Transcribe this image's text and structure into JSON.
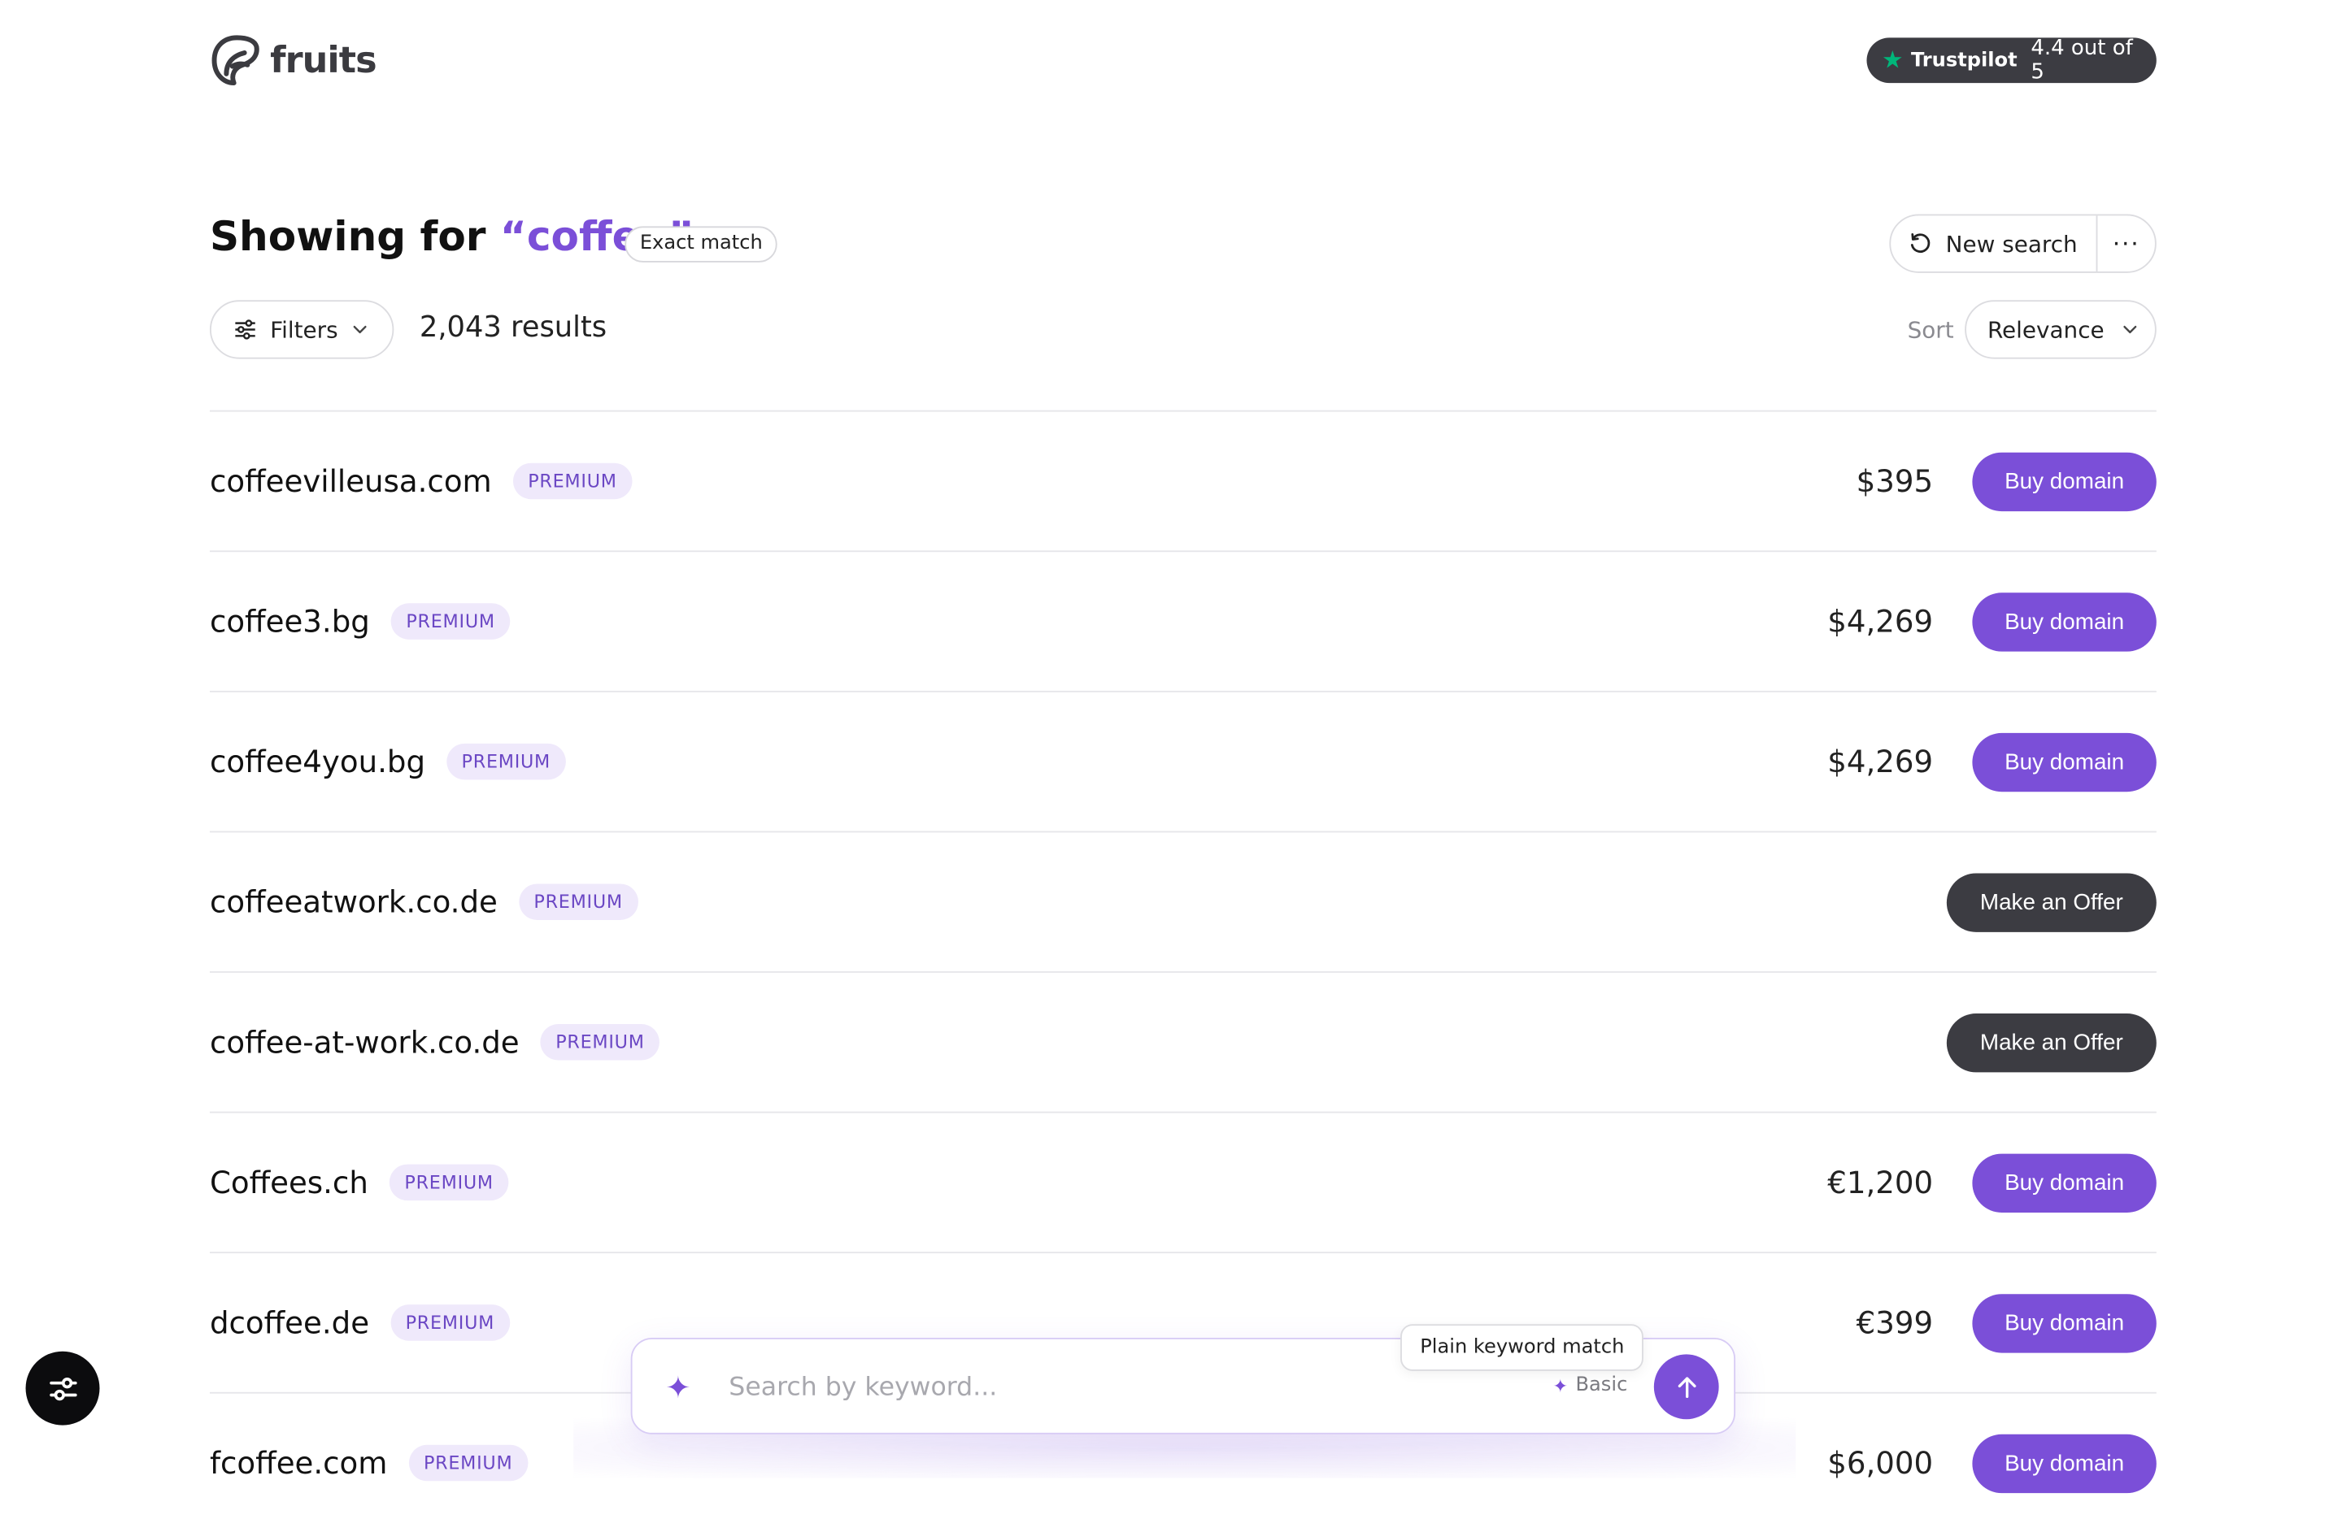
{
  "brand": {
    "name": "fruits"
  },
  "trustpilot": {
    "brand": "Trustpilot",
    "score": "4.4 out of 5"
  },
  "header": {
    "prefix": "Showing for ",
    "query": "“coffee”",
    "match_badge": "Exact match",
    "new_search": "New search",
    "more": "···"
  },
  "toolbar": {
    "filters": "Filters",
    "results": "2,043 results",
    "sort_label": "Sort",
    "sort_value": "Relevance"
  },
  "rows": [
    {
      "domain": "coffeevilleusa.com",
      "badge": "PREMIUM",
      "price": "$395",
      "action": "Buy domain"
    },
    {
      "domain": "coffee3.bg",
      "badge": "PREMIUM",
      "price": "$4,269",
      "action": "Buy domain"
    },
    {
      "domain": "coffee4you.bg",
      "badge": "PREMIUM",
      "price": "$4,269",
      "action": "Buy domain"
    },
    {
      "domain": "coffeeatwork.co.de",
      "badge": "PREMIUM",
      "price": "",
      "action": "Make an Offer"
    },
    {
      "domain": "coffee-at-work.co.de",
      "badge": "PREMIUM",
      "price": "",
      "action": "Make an Offer"
    },
    {
      "domain": "Coffees.ch",
      "badge": "PREMIUM",
      "price": "€1,200",
      "action": "Buy domain"
    },
    {
      "domain": "dcoffee.de",
      "badge": "PREMIUM",
      "price": "€399",
      "action": "Buy domain"
    },
    {
      "domain": "fcoffee.com",
      "badge": "PREMIUM",
      "price": "$6,000",
      "action": "Buy domain"
    }
  ],
  "search": {
    "placeholder": "Search by keyword...",
    "mode": "Basic",
    "tooltip": "Plain keyword match"
  },
  "colors": {
    "accent": "#7b4fd8",
    "dark": "#3c3c42",
    "badge_bg": "#efe9fb",
    "trustpilot_green": "#00b67a"
  },
  "icons": [
    "fruits-logo-icon",
    "trustpilot-star-icon",
    "refresh-icon",
    "more-icon",
    "filter-sliders-icon",
    "chevron-down-icon",
    "sparkle-icon",
    "arrow-up-icon",
    "settings-sliders-icon"
  ]
}
